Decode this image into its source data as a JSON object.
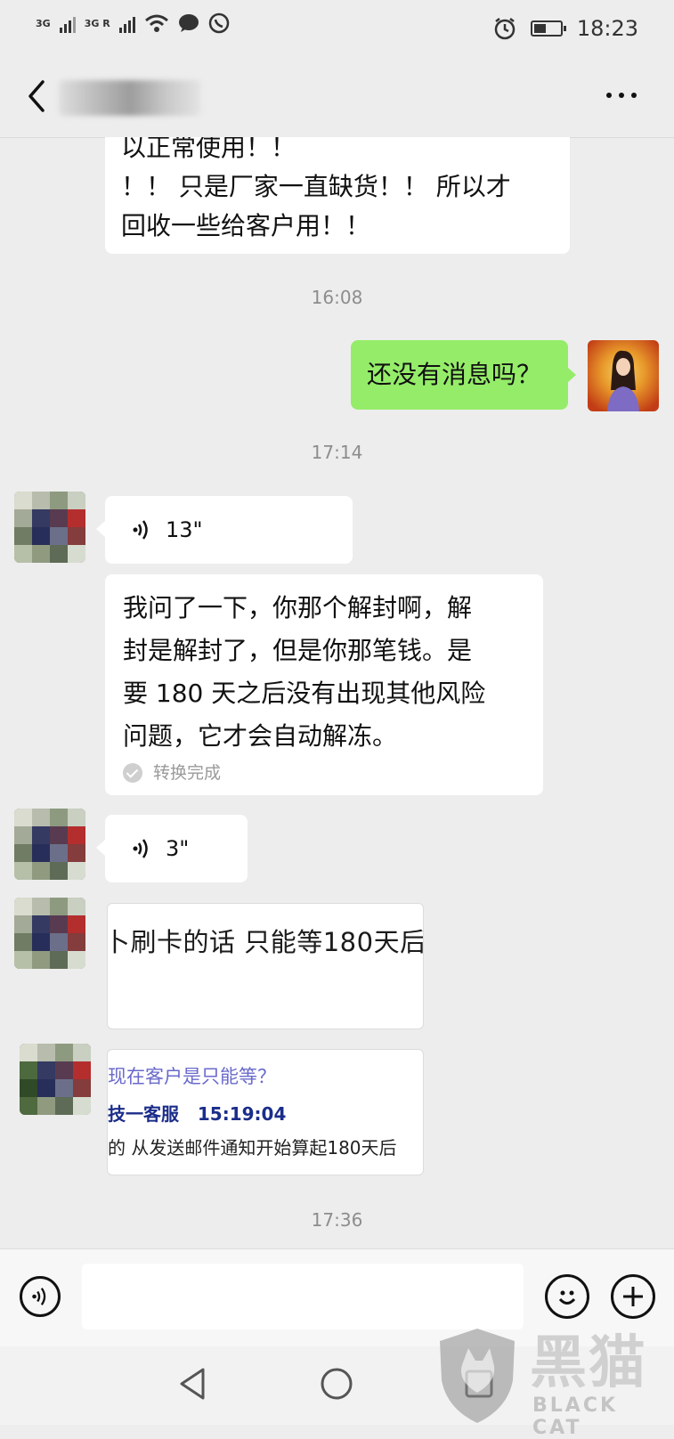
{
  "status_bar": {
    "net1": "3G",
    "net2": "3G R",
    "time": "18:23",
    "battery_level": 0.55
  },
  "header": {
    "title": "",
    "more_icon": "more-dots-icon",
    "back_icon": "back-arrow-icon"
  },
  "messages": {
    "m1_lines": [
      "以正常使用！！",
      "！！ 只是厂家一直缺货！！ 所以才",
      "回收一些给客户用！！"
    ],
    "t1": "16:08",
    "m2": "还没有消息吗？",
    "t2": "17:14",
    "voice1": "13\"",
    "transcript_lines": [
      "我问了一下，你那个解封啊，解",
      "封是解封了，但是你那笔钱。是",
      "要 180 天之后没有出现其他风险",
      "问题，它才会自动解冻。"
    ],
    "transcript_status": "转换完成",
    "voice2": "3\"",
    "img1_text": "卜刷卡的话 只能等180天后",
    "img2_line1": "现在客户是只能等？",
    "img2_line2_name": "技一客服",
    "img2_line2_time": "15:19:04",
    "img2_line3": "的 从发送邮件通知开始算起180天后",
    "t3": "17:36"
  },
  "watermark": {
    "text": "黑猫",
    "sub": "BLACK CAT"
  },
  "colors": {
    "sent_bubble": "#95ec69",
    "received_bubble": "#ffffff",
    "background": "#ededed"
  }
}
